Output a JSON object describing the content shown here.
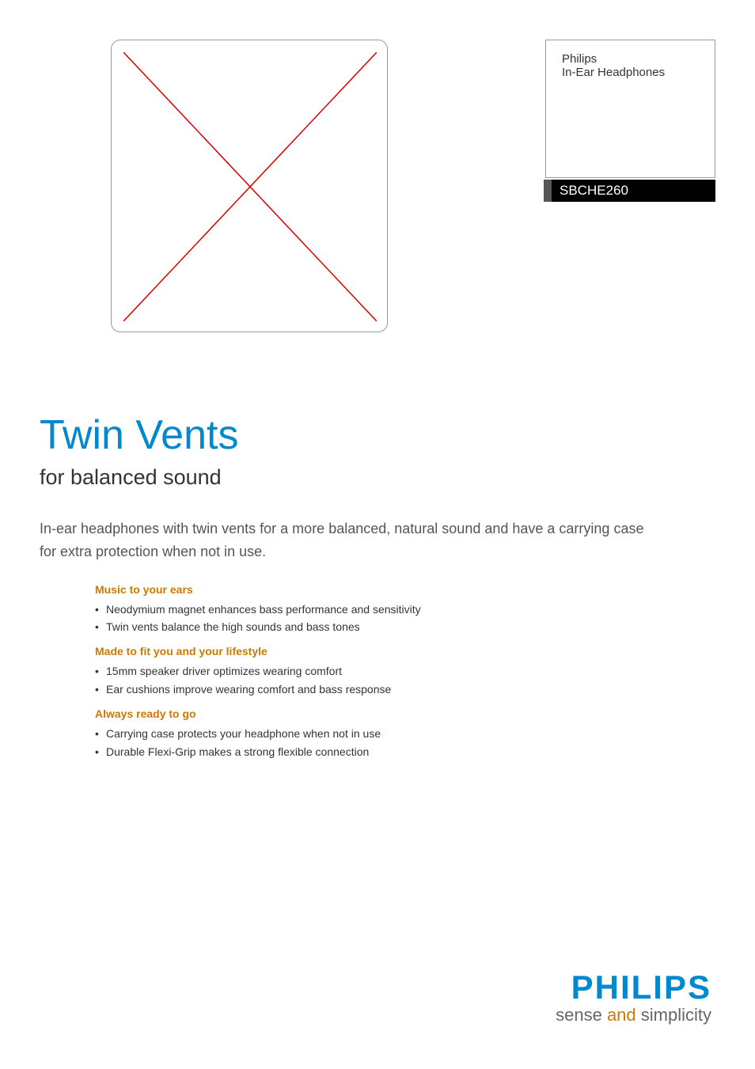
{
  "product": {
    "brand": "Philips",
    "category": "In-Ear Headphones",
    "model": "SBCHE260"
  },
  "headline": "Twin Vents",
  "subheadline": "for balanced sound",
  "description": "In-ear headphones with twin vents for a more balanced, natural sound and have a carrying case for extra protection when not in use.",
  "feature_groups": [
    {
      "heading": "Music to your ears",
      "items": [
        "Neodymium magnet enhances bass performance and sensitivity",
        "Twin vents balance the high sounds and bass tones"
      ]
    },
    {
      "heading": "Made to fit you and your lifestyle",
      "items": [
        "15mm speaker driver optimizes wearing comfort",
        "Ear cushions improve wearing comfort and bass response"
      ]
    },
    {
      "heading": "Always ready to go",
      "items": [
        "Carrying case protects your headphone when not in use",
        "Durable Flexi-Grip makes a strong flexible connection"
      ]
    }
  ],
  "logo": {
    "brand": "PHILIPS",
    "tagline_sense": "sense ",
    "tagline_and": "and",
    "tagline_simplicity": " simplicity"
  }
}
